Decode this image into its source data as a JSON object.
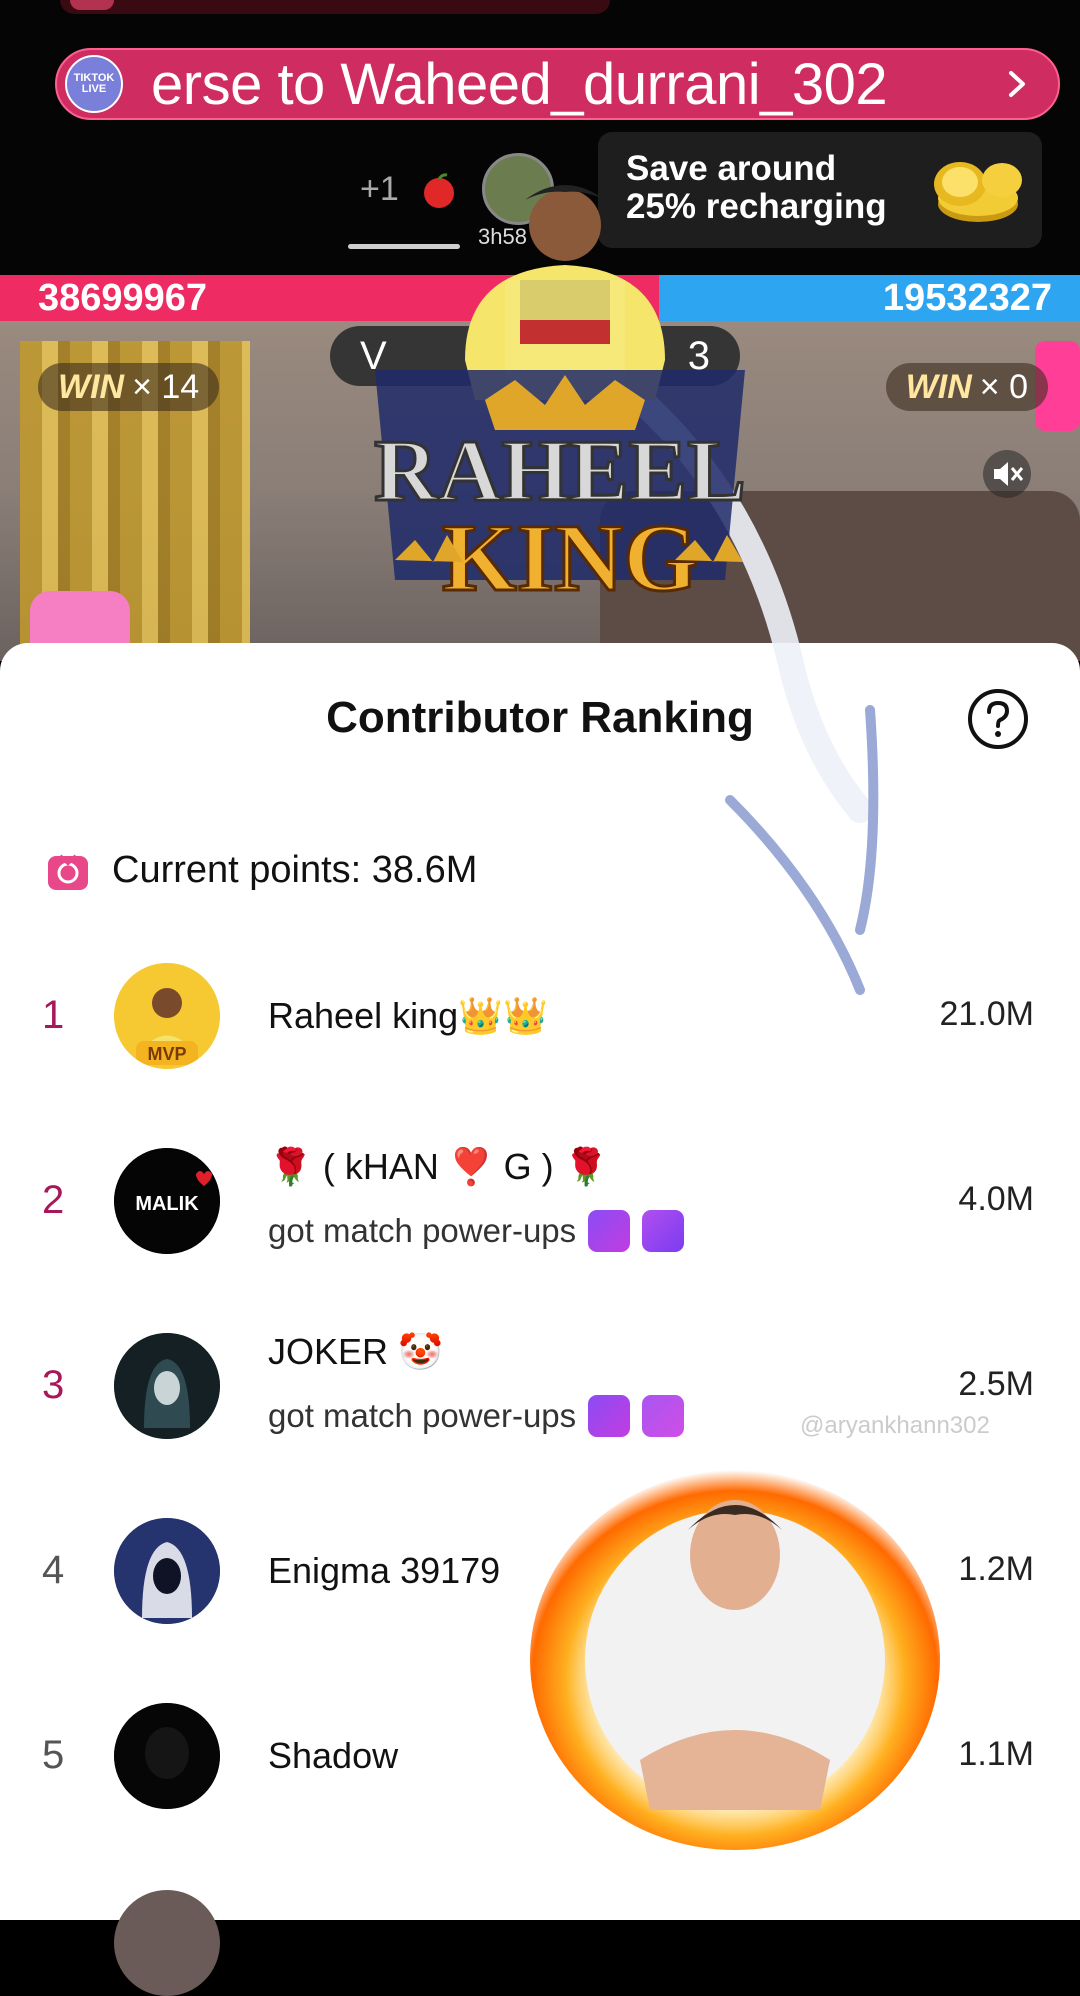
{
  "banner": {
    "text": "erse to Waheed_durrani_302",
    "logo_text": "TIKTOK LIVE"
  },
  "header": {
    "plus_count": "+1",
    "host_timer": "3h58"
  },
  "promo": {
    "line1": "Save around",
    "line2": "25% recharging",
    "icon": "gold-coins-icon"
  },
  "battle": {
    "left_score": "38699967",
    "right_score": "19532327",
    "left_win_label": "WIN",
    "left_win_count": "× 14",
    "right_win_label": "WIN",
    "right_win_count": "× 0",
    "center_left": "V",
    "center_right": "3",
    "left_color": "#ee2b62",
    "right_color": "#2da5f0"
  },
  "sticker": {
    "line1": "RAHEEL",
    "line2": "KING"
  },
  "ranking": {
    "title": "Contributor Ranking",
    "current_points_label": "Current points: 38.6M",
    "rows": [
      {
        "rank": "1",
        "name": "Raheel king👑👑",
        "sub": "",
        "score": "21.0M",
        "badge": "MVP"
      },
      {
        "rank": "2",
        "name": "🌹 ( kHAN ❣️ G ) 🌹",
        "sub": "got match power-ups",
        "score": "4.0M",
        "avatar_text": "MALIK"
      },
      {
        "rank": "3",
        "name": "JOKER 🤡",
        "sub": "got match power-ups",
        "score": "2.5M"
      },
      {
        "rank": "4",
        "name": "Enigma 39179",
        "sub": "",
        "score": "1.2M"
      },
      {
        "rank": "5",
        "name": "Shadow",
        "sub": "",
        "score": "1.1M"
      }
    ]
  },
  "watermark": "@aryankhann302"
}
